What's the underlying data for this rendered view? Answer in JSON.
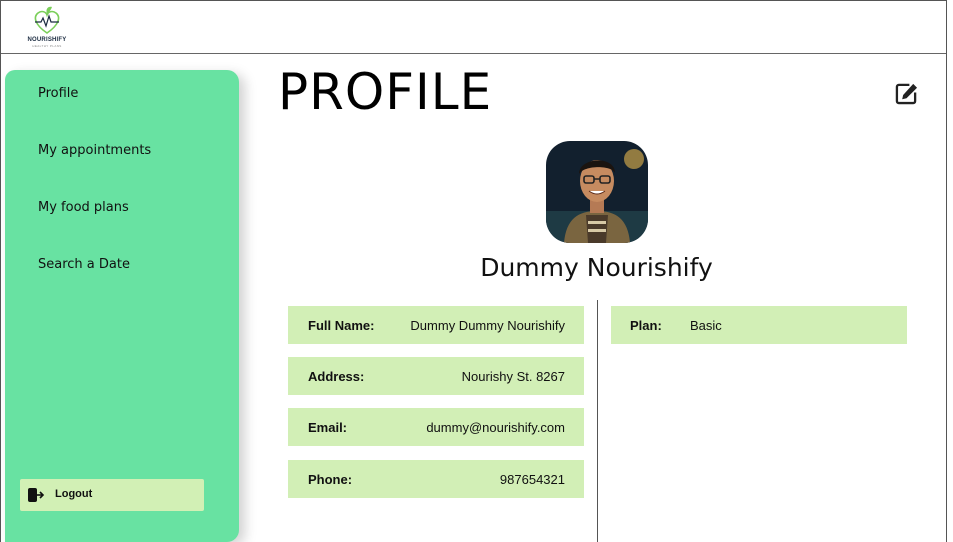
{
  "header": {
    "brand": "NOURISHIFY",
    "tagline": "HEALTHY PLANS"
  },
  "sidebar": {
    "items": [
      {
        "label": "Profile"
      },
      {
        "label": "My appointments"
      },
      {
        "label": "My food plans"
      },
      {
        "label": "Search a Date"
      }
    ],
    "logout_label": "Logout"
  },
  "main": {
    "title": "PROFILE",
    "user_name": "Dummy Nourishify",
    "details": [
      {
        "key": "Full Name:",
        "value": "Dummy Dummy Nourishify"
      },
      {
        "key": "Address:",
        "value": "Nourishy St. 8267"
      },
      {
        "key": "Email:",
        "value": "dummy@nourishify.com"
      },
      {
        "key": "Phone:",
        "value": "987654321"
      }
    ],
    "plan": {
      "key": "Plan:",
      "value": "Basic"
    }
  },
  "colors": {
    "sidebar": "#68e2a2",
    "field_bg": "#d2efb6",
    "logout_bg": "#d2f0b5"
  },
  "icons": {
    "edit": "edit-icon",
    "logout": "logout-icon",
    "logo": "heart-leaf-logo"
  }
}
